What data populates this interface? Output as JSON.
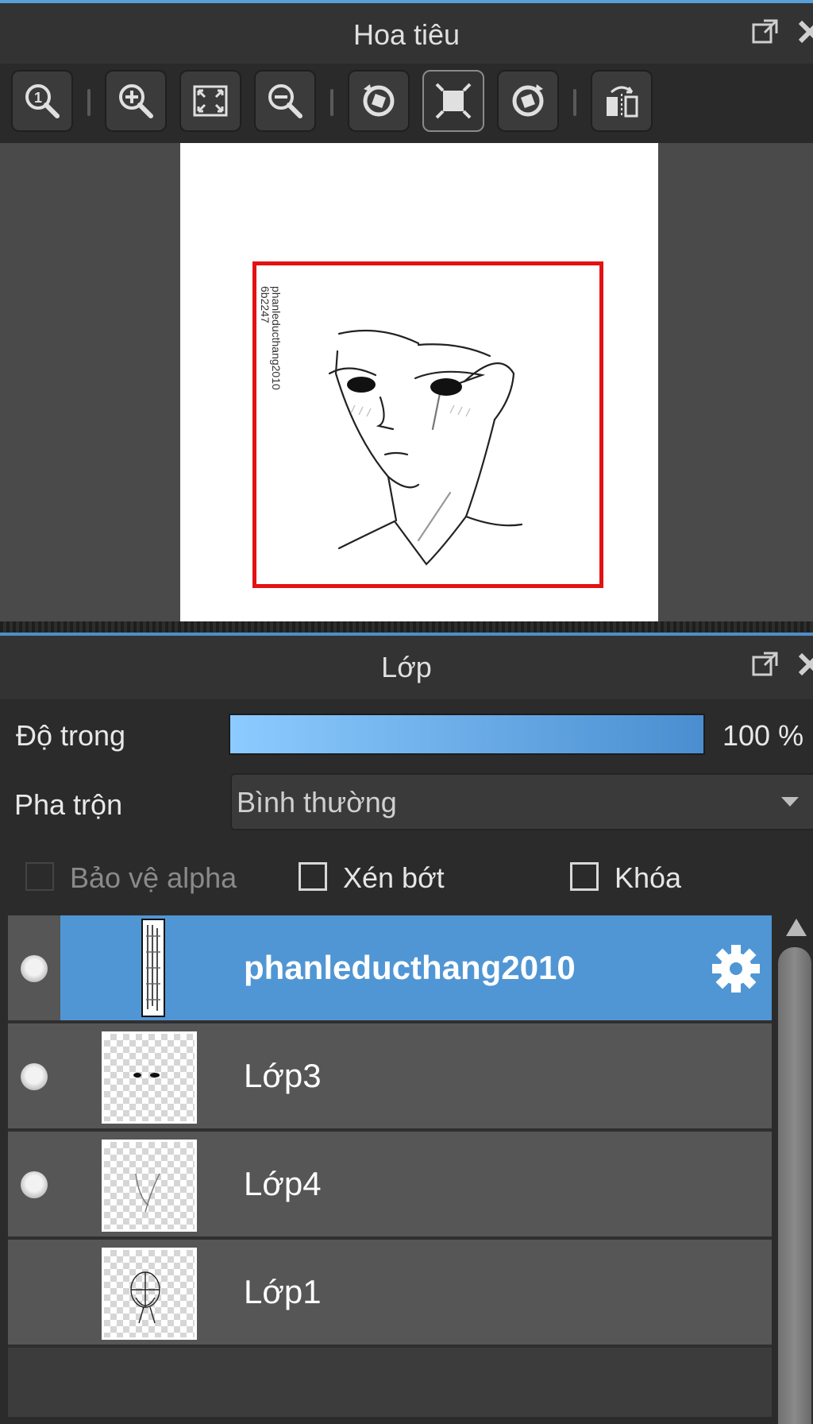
{
  "navigator": {
    "title": "Hoa tiêu",
    "preview_watermark": "phanleducthang2010 &nbsp;6b2247",
    "toolbar": [
      {
        "name": "zoom-100-button",
        "icon": "zoom-actual-size-icon"
      },
      {
        "name": "zoom-in-button",
        "icon": "zoom-in-icon"
      },
      {
        "name": "fit-window-button",
        "icon": "fit-window-icon"
      },
      {
        "name": "zoom-out-button",
        "icon": "zoom-out-icon"
      },
      {
        "name": "rotate-left-button",
        "icon": "rotate-left-icon"
      },
      {
        "name": "reset-view-button",
        "icon": "reset-view-icon"
      },
      {
        "name": "rotate-right-button",
        "icon": "rotate-right-icon"
      },
      {
        "name": "flip-horizontal-button",
        "icon": "flip-horizontal-icon"
      }
    ]
  },
  "layers_panel": {
    "title": "Lớp",
    "opacity_label": "Độ trong",
    "opacity_value": "100 %",
    "opacity_fraction": 1.0,
    "blend_label": "Pha trộn",
    "blend_value": "Bình thường",
    "protect_alpha_label": "Bảo vệ alpha",
    "clipping_label": "Xén bớt",
    "lock_label": "Khóa",
    "layers": [
      {
        "name": "phanleducthang2010",
        "visible": true,
        "selected": true,
        "type": "text"
      },
      {
        "name": "Lớp3",
        "visible": true,
        "selected": false,
        "type": "raster"
      },
      {
        "name": "Lớp4",
        "visible": true,
        "selected": false,
        "type": "raster"
      },
      {
        "name": "Lớp1",
        "visible": false,
        "selected": false,
        "type": "raster"
      }
    ]
  },
  "colors": {
    "accent": "#5096d4",
    "viewport_rect": "#e41212",
    "panel_bg": "#2b2b2b"
  }
}
